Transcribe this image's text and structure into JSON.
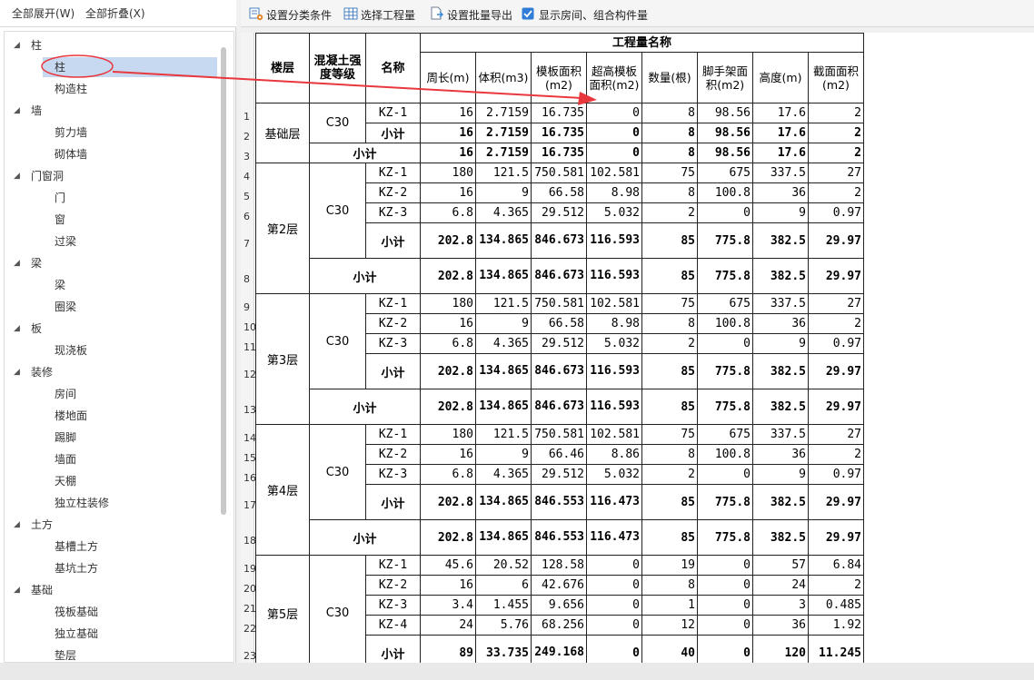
{
  "left_toolbar": {
    "expand_all": "全部展开(W)",
    "collapse_all": "全部折叠(X)"
  },
  "toolbar": {
    "set_condition": "设置分类条件",
    "select_quantity": "选择工程量",
    "batch_export": "设置批量导出",
    "show_rooms": "显示房间、组合构件量",
    "show_rooms_checked": true
  },
  "tree": [
    {
      "label": "柱",
      "level": 0
    },
    {
      "label": "柱",
      "level": 1,
      "selected": true
    },
    {
      "label": "构造柱",
      "level": 1
    },
    {
      "label": "墙",
      "level": 0
    },
    {
      "label": "剪力墙",
      "level": 1
    },
    {
      "label": "砌体墙",
      "level": 1
    },
    {
      "label": "门窗洞",
      "level": 0
    },
    {
      "label": "门",
      "level": 1
    },
    {
      "label": "窗",
      "level": 1
    },
    {
      "label": "过梁",
      "level": 1
    },
    {
      "label": "梁",
      "level": 0
    },
    {
      "label": "梁",
      "level": 1
    },
    {
      "label": "圈梁",
      "level": 1
    },
    {
      "label": "板",
      "level": 0
    },
    {
      "label": "现浇板",
      "level": 1
    },
    {
      "label": "装修",
      "level": 0
    },
    {
      "label": "房间",
      "level": 1
    },
    {
      "label": "楼地面",
      "level": 1
    },
    {
      "label": "踢脚",
      "level": 1
    },
    {
      "label": "墙面",
      "level": 1
    },
    {
      "label": "天棚",
      "level": 1
    },
    {
      "label": "独立柱装修",
      "level": 1
    },
    {
      "label": "土方",
      "level": 0
    },
    {
      "label": "基槽土方",
      "level": 1
    },
    {
      "label": "基坑土方",
      "level": 1
    },
    {
      "label": "基础",
      "level": 0
    },
    {
      "label": "筏板基础",
      "level": 1
    },
    {
      "label": "独立基础",
      "level": 1
    },
    {
      "label": "垫层",
      "level": 1
    }
  ],
  "table": {
    "header_floor": "楼层",
    "header_grade": "混凝土强度等级",
    "header_name": "名称",
    "header_group": "工程量名称",
    "columns": [
      "周长(m)",
      "体积(m3)",
      "模板面积(m2)",
      "超高模板面积(m2)",
      "数量(根)",
      "脚手架面积(m2)",
      "高度(m)",
      "截面面积(m2)"
    ],
    "row_numbers": [
      "1",
      "2",
      "3",
      "4",
      "5",
      "6",
      "7",
      "8",
      "9",
      "10",
      "11",
      "12",
      "13",
      "14",
      "15",
      "16",
      "17",
      "18",
      "19",
      "20",
      "21",
      "22",
      "23"
    ],
    "floors": [
      {
        "floor": "基础层",
        "grade": "C30",
        "rows": [
          {
            "name": "KZ-1",
            "values": [
              "16",
              "2.7159",
              "16.735",
              "0",
              "8",
              "98.56",
              "17.6",
              "2"
            ]
          }
        ],
        "grade_subtotal": [
          "16",
          "2.7159",
          "16.735",
          "0",
          "8",
          "98.56",
          "17.6",
          "2"
        ],
        "floor_subtotal": [
          "16",
          "2.7159",
          "16.735",
          "0",
          "8",
          "98.56",
          "17.6",
          "2"
        ]
      },
      {
        "floor": "第2层",
        "grade": "C30",
        "rows": [
          {
            "name": "KZ-1",
            "values": [
              "180",
              "121.5",
              "750.581",
              "102.581",
              "75",
              "675",
              "337.5",
              "27"
            ]
          },
          {
            "name": "KZ-2",
            "values": [
              "16",
              "9",
              "66.58",
              "8.98",
              "8",
              "100.8",
              "36",
              "2"
            ]
          },
          {
            "name": "KZ-3",
            "values": [
              "6.8",
              "4.365",
              "29.512",
              "5.032",
              "2",
              "0",
              "9",
              "0.97"
            ]
          }
        ],
        "grade_subtotal": [
          "202.8",
          "134.865",
          "846.673",
          "116.593",
          "85",
          "775.8",
          "382.5",
          "29.97"
        ],
        "floor_subtotal": [
          "202.8",
          "134.865",
          "846.673",
          "116.593",
          "85",
          "775.8",
          "382.5",
          "29.97"
        ]
      },
      {
        "floor": "第3层",
        "grade": "C30",
        "rows": [
          {
            "name": "KZ-1",
            "values": [
              "180",
              "121.5",
              "750.581",
              "102.581",
              "75",
              "675",
              "337.5",
              "27"
            ]
          },
          {
            "name": "KZ-2",
            "values": [
              "16",
              "9",
              "66.58",
              "8.98",
              "8",
              "100.8",
              "36",
              "2"
            ]
          },
          {
            "name": "KZ-3",
            "values": [
              "6.8",
              "4.365",
              "29.512",
              "5.032",
              "2",
              "0",
              "9",
              "0.97"
            ]
          }
        ],
        "grade_subtotal": [
          "202.8",
          "134.865",
          "846.673",
          "116.593",
          "85",
          "775.8",
          "382.5",
          "29.97"
        ],
        "floor_subtotal": [
          "202.8",
          "134.865",
          "846.673",
          "116.593",
          "85",
          "775.8",
          "382.5",
          "29.97"
        ]
      },
      {
        "floor": "第4层",
        "grade": "C30",
        "rows": [
          {
            "name": "KZ-1",
            "values": [
              "180",
              "121.5",
              "750.581",
              "102.581",
              "75",
              "675",
              "337.5",
              "27"
            ]
          },
          {
            "name": "KZ-2",
            "values": [
              "16",
              "9",
              "66.46",
              "8.86",
              "8",
              "100.8",
              "36",
              "2"
            ]
          },
          {
            "name": "KZ-3",
            "values": [
              "6.8",
              "4.365",
              "29.512",
              "5.032",
              "2",
              "0",
              "9",
              "0.97"
            ]
          }
        ],
        "grade_subtotal": [
          "202.8",
          "134.865",
          "846.553",
          "116.473",
          "85",
          "775.8",
          "382.5",
          "29.97"
        ],
        "floor_subtotal": [
          "202.8",
          "134.865",
          "846.553",
          "116.473",
          "85",
          "775.8",
          "382.5",
          "29.97"
        ]
      },
      {
        "floor": "第5层",
        "grade": "C30",
        "rows": [
          {
            "name": "KZ-1",
            "values": [
              "45.6",
              "20.52",
              "128.58",
              "0",
              "19",
              "0",
              "57",
              "6.84"
            ]
          },
          {
            "name": "KZ-2",
            "values": [
              "16",
              "6",
              "42.676",
              "0",
              "8",
              "0",
              "24",
              "2"
            ]
          },
          {
            "name": "KZ-3",
            "values": [
              "3.4",
              "1.455",
              "9.656",
              "0",
              "1",
              "0",
              "3",
              "0.485"
            ]
          },
          {
            "name": "KZ-4",
            "values": [
              "24",
              "5.76",
              "68.256",
              "0",
              "12",
              "0",
              "36",
              "1.92"
            ]
          }
        ],
        "grade_subtotal": [
          "89",
          "33.735",
          "249.168",
          "0",
          "40",
          "0",
          "120",
          "11.245"
        ]
      }
    ],
    "subtotal_label": "小计"
  },
  "colors": {
    "annotation": "#e8383d",
    "selected_bg": "#c6d9f0",
    "checkbox": "#2f7dd6"
  }
}
